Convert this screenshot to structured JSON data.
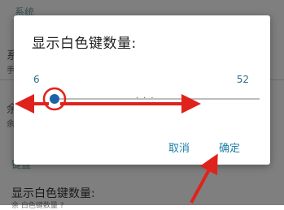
{
  "background": {
    "section_header_1": "系统",
    "row_title_1": "系",
    "row_sub_1": "手",
    "row_title_2": "余",
    "row_sub_2": "余",
    "section_header_2": "键盘",
    "row_title_3": "显示白色键数量:",
    "row_sub_3": "余 白色键数量 ?"
  },
  "dialog": {
    "title": "显示白色键数量:",
    "slider": {
      "min_label": "6",
      "max_label": "52",
      "min": 6,
      "max": 52,
      "value": 6
    },
    "buttons": {
      "cancel_label": "取消",
      "ok_label": "确定"
    }
  },
  "colors": {
    "accent": "#2070a8",
    "annotation_red": "#e0221c",
    "button_text": "#1f7ea5"
  },
  "annotations": [
    "red-double-arrow",
    "red-circle-around-thumb",
    "red-arrow-to-ok"
  ]
}
